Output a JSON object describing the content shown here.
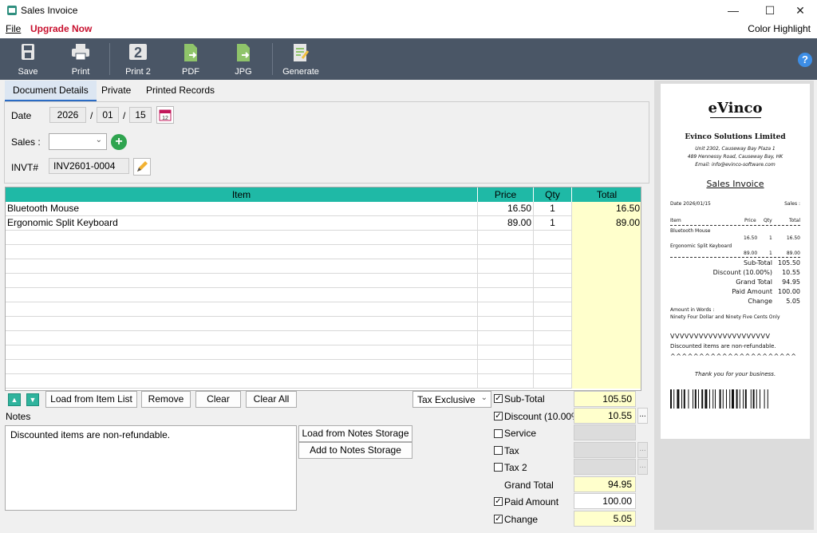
{
  "window": {
    "title": "Sales Invoice",
    "minimize": "—",
    "maximize": "☐",
    "close": "✕"
  },
  "menu": {
    "file": "File",
    "upgrade": "Upgrade Now",
    "color_highlight": "Color Highlight"
  },
  "toolbar": {
    "save": "Save",
    "print": "Print",
    "print2": "Print 2",
    "print2_num": "2",
    "pdf": "PDF",
    "jpg": "JPG",
    "generate": "Generate",
    "help": "?"
  },
  "tabs": [
    "Document Details",
    "Private",
    "Printed Records"
  ],
  "doc": {
    "date_label": "Date",
    "year": "2026",
    "month": "01",
    "day": "15",
    "sep": "/",
    "sales_label": "Sales :",
    "sales_value": "",
    "invt_label": "INVT#",
    "invt_value": "INV2601-0004"
  },
  "grid": {
    "headers": [
      "Item",
      "Price",
      "Qty",
      "Total"
    ],
    "rows": [
      {
        "item": "Bluetooth Mouse",
        "price": "16.50",
        "qty": "1",
        "total": "16.50"
      },
      {
        "item": "Ergonomic Split Keyboard",
        "price": "89.00",
        "qty": "1",
        "total": "89.00"
      }
    ]
  },
  "buttons": {
    "load_item": "Load from Item List",
    "remove": "Remove",
    "clear": "Clear",
    "clear_all": "Clear All",
    "tax_mode": "Tax Exclusive",
    "load_notes": "Load from Notes Storage",
    "add_notes": "Add to Notes Storage"
  },
  "notes": {
    "label": "Notes",
    "text": "Discounted items are non-refundable."
  },
  "summary": {
    "subtotal_label": "Sub-Total",
    "subtotal": "105.50",
    "discount_label": "Discount (10.00%",
    "discount": "10.55",
    "service_label": "Service",
    "tax_label": "Tax",
    "tax2_label": "Tax 2",
    "grand_label": "Grand Total",
    "grand": "94.95",
    "paid_label": "Paid Amount",
    "paid": "100.00",
    "change_label": "Change",
    "change": "5.05",
    "dots": "..."
  },
  "receipt": {
    "logo": "eVinco",
    "company": "Evinco Solutions Limited",
    "addr1": "Unit 2302, Causeway Bay Plaza 1",
    "addr2": "489 Hennessy Road, Causeway Bay, HK",
    "email": "Email: info@evinco-software.com",
    "doc_title": "Sales Invoice",
    "date": "Date 2026/01/15",
    "sales": "Sales :",
    "h_item": "Item",
    "h_price": "Price",
    "h_qty": "Qty",
    "h_total": "Total",
    "items": [
      {
        "name": "Bluetooth Mouse",
        "price": "16.50",
        "qty": "1",
        "total": "16.50"
      },
      {
        "name": "Ergonomic Split Keyboard",
        "price": "89.00",
        "qty": "1",
        "total": "89.00"
      }
    ],
    "sum": [
      {
        "label": "Sub-Total",
        "value": "105.50"
      },
      {
        "label": "Discount (10.00%)",
        "value": "10.55"
      },
      {
        "label": "Grand Total",
        "value": "94.95"
      },
      {
        "label": "Paid Amount",
        "value": "100.00"
      },
      {
        "label": "Change",
        "value": "5.05"
      }
    ],
    "words_label": "Amount in Words :",
    "words": "Ninety Four Dollar and Ninety Five Cents Only",
    "vline": "VVVVVVVVVVVVVVVVVVVVV",
    "note": "Discounted items are non-refundable.",
    "aline": "^^^^^^^^^^^^^^^^^^^^^^",
    "thanks": "Thank you for your business."
  }
}
